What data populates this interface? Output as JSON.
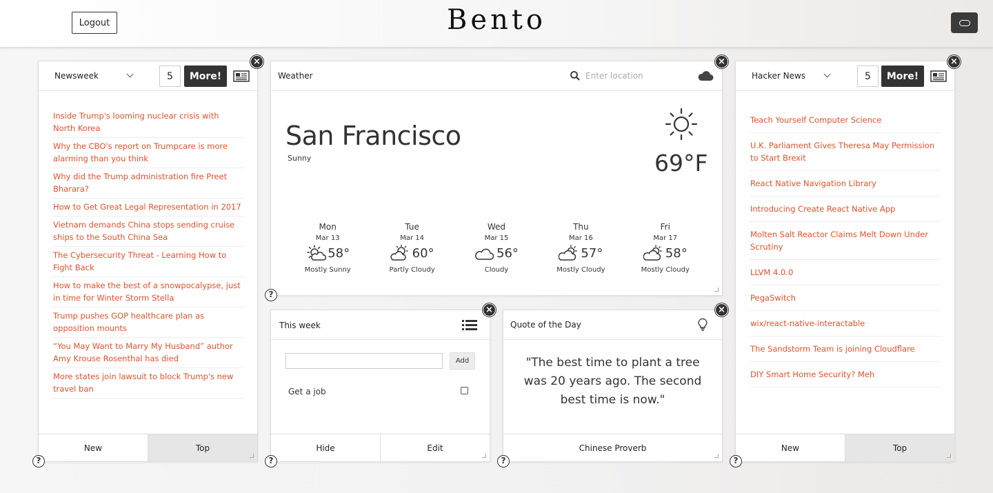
{
  "header": {
    "logout_label": "Logout",
    "brand": "Bento",
    "toggle_icon": "toggle-icon"
  },
  "left_news": {
    "source": "Newsweek",
    "count": "5",
    "more_label": "More!",
    "items": [
      "Inside Trump's looming nuclear crisis with North Korea",
      "Why the CBO's report on Trumpcare is more alarming than you think",
      "Why did the Trump administration fire Preet Bharara?",
      "How to Get Great Legal Representation in 2017",
      "Vietnam demands China stops sending cruise ships to the South China Sea",
      "The Cybersecurity Threat - Learning How to Fight Back",
      "How to make the best of a snowpocalypse, just in time for Winter Storm Stella",
      "Trump pushes GOP healthcare plan as opposition mounts",
      "“You May Want to Marry My Husband” author Amy Krouse Rosenthal has died",
      "More states join lawsuit to block Trump's new travel ban"
    ],
    "footer": {
      "new_label": "New",
      "top_label": "Top",
      "active": "Top"
    }
  },
  "weather": {
    "title": "Weather",
    "search_placeholder": "Enter location",
    "city": "San Francisco",
    "condition": "Sunny",
    "temperature": "69°F",
    "forecast": [
      {
        "day": "Mon",
        "date": "Mar 13",
        "temp": "58°",
        "condition": "Mostly Sunny",
        "icon": "mostly-sunny-icon"
      },
      {
        "day": "Tue",
        "date": "Mar 14",
        "temp": "60°",
        "condition": "Partly Cloudy",
        "icon": "partly-cloudy-icon"
      },
      {
        "day": "Wed",
        "date": "Mar 15",
        "temp": "56°",
        "condition": "Cloudy",
        "icon": "cloudy-icon"
      },
      {
        "day": "Thu",
        "date": "Mar 16",
        "temp": "57°",
        "condition": "Mostly Cloudy",
        "icon": "mostly-cloudy-icon"
      },
      {
        "day": "Fri",
        "date": "Mar 17",
        "temp": "58°",
        "condition": "Mostly Cloudy",
        "icon": "mostly-cloudy-icon"
      }
    ]
  },
  "todo": {
    "title": "This week",
    "input_value": "",
    "add_label": "Add",
    "items": [
      {
        "text": "Get a job",
        "checked": false
      }
    ],
    "footer": {
      "hide_label": "Hide",
      "edit_label": "Edit"
    }
  },
  "quote": {
    "title": "Quote of the Day",
    "text": "\"The best time to plant a tree was 20 years ago. The second best time is now.\"",
    "author": "Chinese Proverb"
  },
  "right_news": {
    "source": "Hacker News",
    "count": "5",
    "more_label": "More!",
    "items": [
      "Teach Yourself Computer Science",
      "U.K. Parliament Gives Theresa May Permission to Start Brexit",
      "React Native Navigation Library",
      "Introducing Create React Native App",
      "Molten Salt Reactor Claims Melt Down Under Scrutiny",
      "LLVM 4.0.0",
      "PegaSwitch",
      "wix/react-native-interactable",
      "The Sandstorm Team is joining Cloudflare",
      "DIY Smart Home Security? Meh"
    ],
    "footer": {
      "new_label": "New",
      "top_label": "Top",
      "active": "Top"
    }
  },
  "colors": {
    "link": "#e8502a",
    "dark": "#333333",
    "active_tab": "#e6e6e6"
  }
}
